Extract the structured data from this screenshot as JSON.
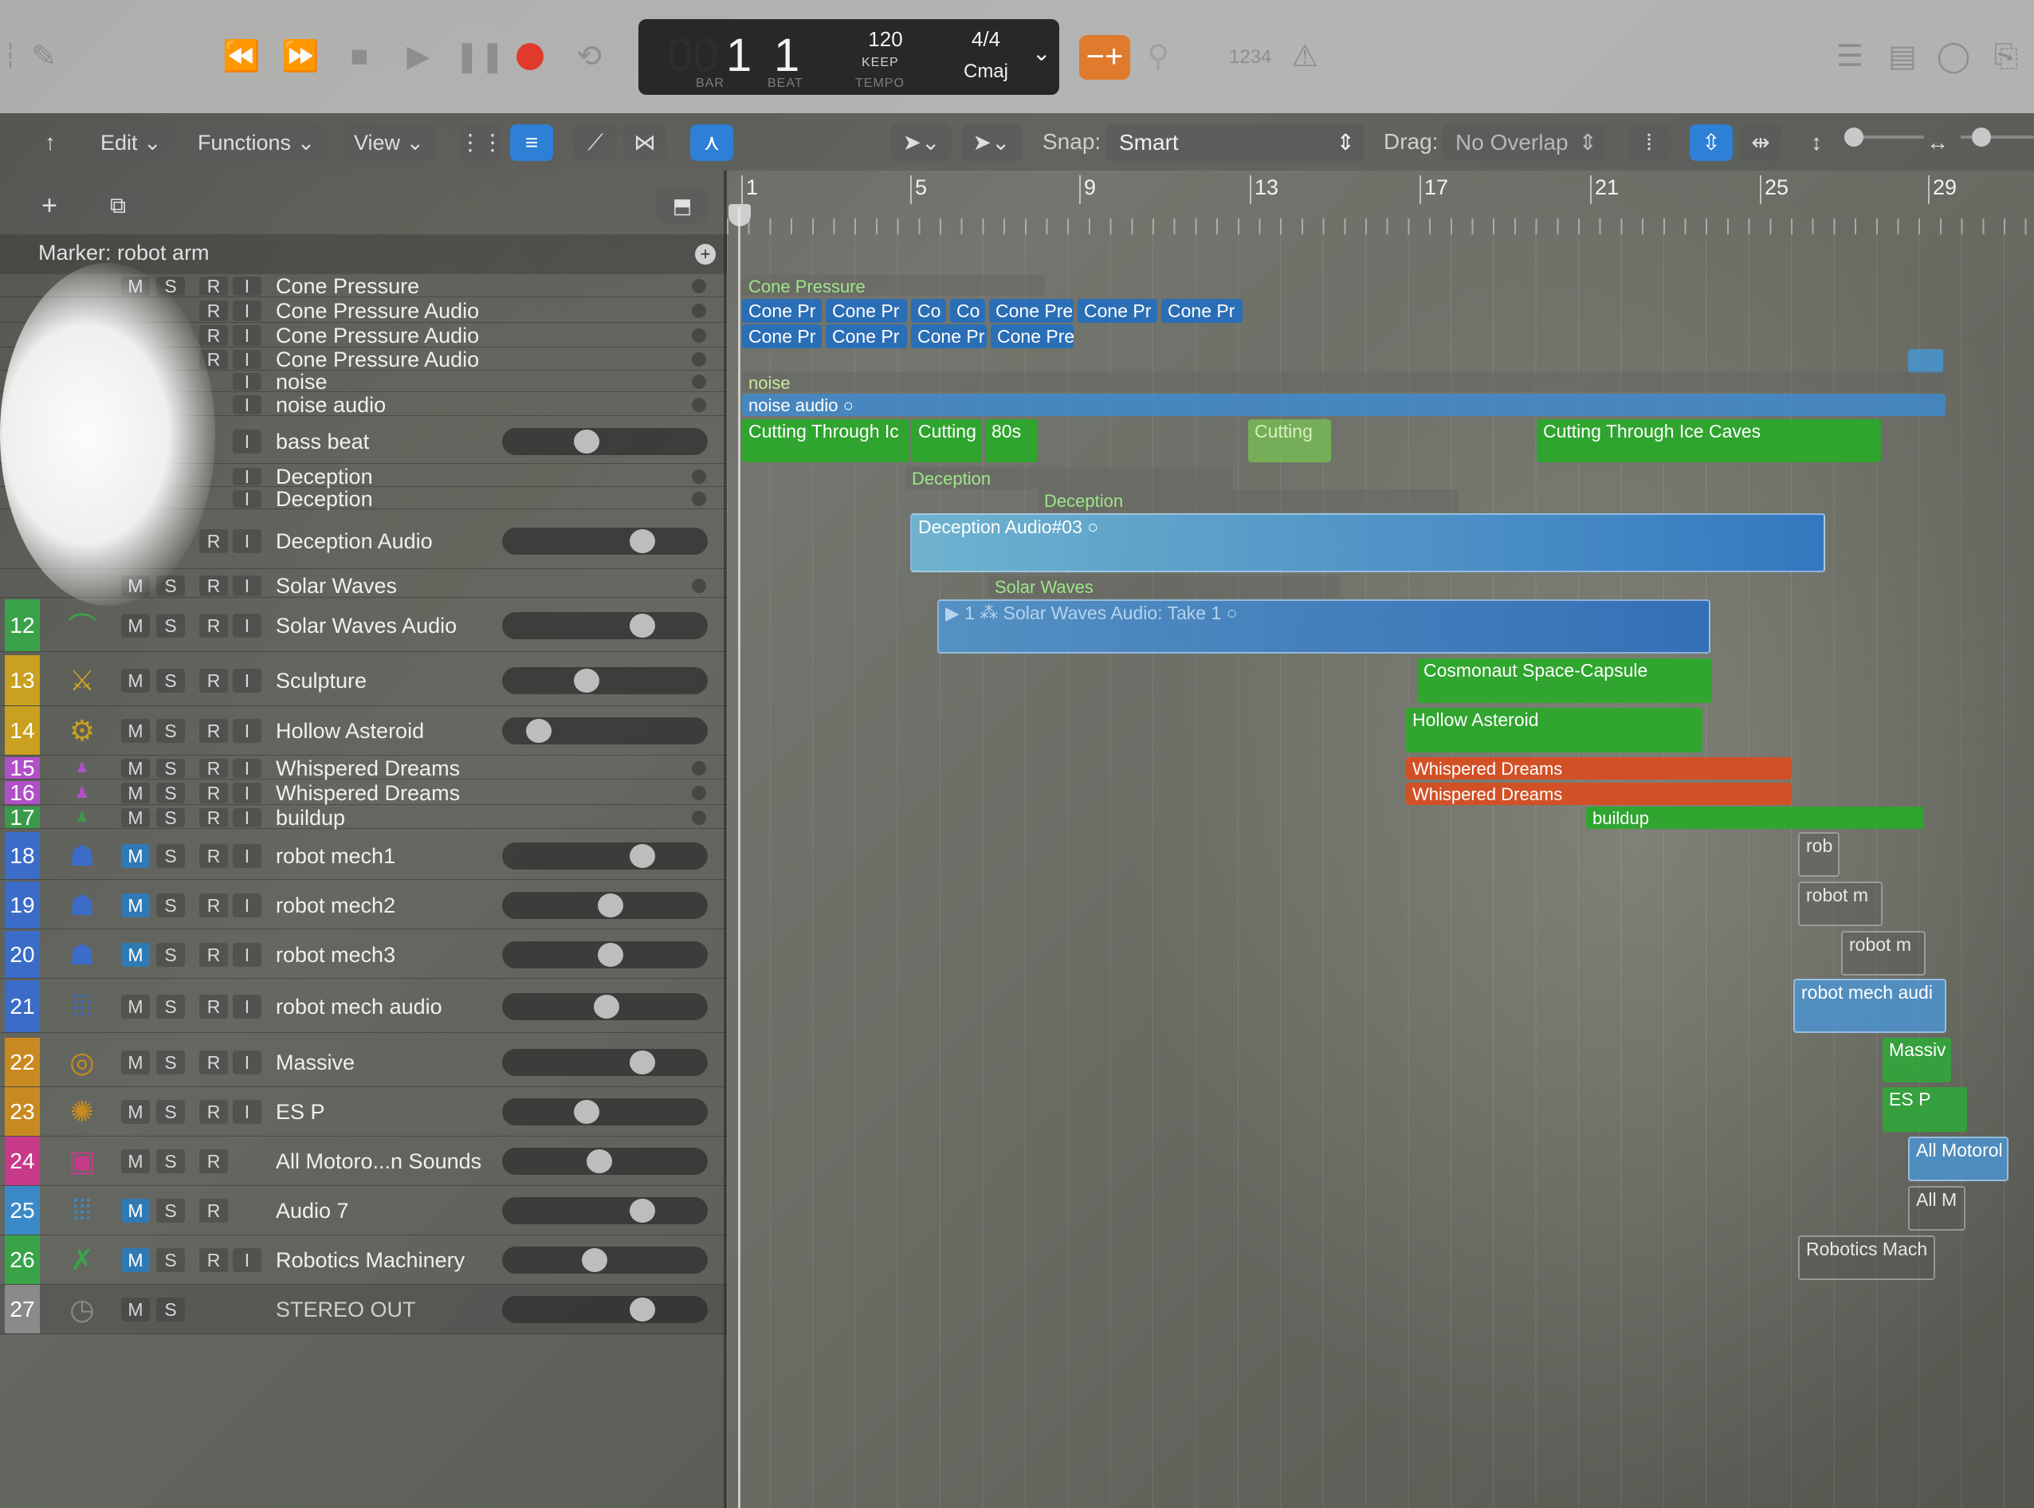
{
  "transport": {
    "bar": "00",
    "bar_value": "1",
    "beat_value": "1",
    "bar_label": "BAR",
    "beat_label": "BEAT",
    "tempo_value": "120",
    "tempo_mode": "KEEP",
    "tempo_label": "TEMPO",
    "time_signature": "4/4",
    "key": "Cmaj",
    "count_in": "1234",
    "record_color": "#e03a2c",
    "accent_color": "#e07a2c"
  },
  "toolbar": {
    "edit": "Edit",
    "functions": "Functions",
    "view": "View",
    "snap_label": "Snap:",
    "snap_value": "Smart",
    "drag_label": "Drag:",
    "drag_value": "No Overlap"
  },
  "marker": {
    "text": "Marker: robot arm"
  },
  "ruler": [
    "1",
    "5",
    "9",
    "13",
    "17",
    "21",
    "25",
    "29"
  ],
  "tracks": [
    {
      "num": "",
      "name": "Cone Pressure",
      "m": "M",
      "s": "S",
      "r": "R",
      "i": "I"
    },
    {
      "num": "",
      "name": "Cone Pressure Audio",
      "m": "",
      "s": "",
      "r": "R",
      "i": "I"
    },
    {
      "num": "",
      "name": "Cone Pressure Audio",
      "m": "",
      "s": "",
      "r": "R",
      "i": "I"
    },
    {
      "num": "",
      "name": "Cone Pressure Audio",
      "m": "",
      "s": "",
      "r": "R",
      "i": "I"
    },
    {
      "num": "",
      "name": "noise",
      "m": "",
      "s": "",
      "r": "",
      "i": "I"
    },
    {
      "num": "",
      "name": "noise audio",
      "m": "",
      "s": "",
      "r": "",
      "i": "I"
    },
    {
      "num": "",
      "name": "bass beat",
      "m": "",
      "s": "",
      "r": "",
      "i": "I"
    },
    {
      "num": "",
      "name": "Deception",
      "m": "",
      "s": "",
      "r": "",
      "i": "I"
    },
    {
      "num": "",
      "name": "Deception",
      "m": "",
      "s": "",
      "r": "",
      "i": "I"
    },
    {
      "num": "",
      "name": "Deception Audio",
      "m": "",
      "s": "",
      "r": "R",
      "i": "I"
    },
    {
      "num": "",
      "name": "Solar Waves",
      "m": "M",
      "s": "S",
      "r": "R",
      "i": "I"
    },
    {
      "num": "12",
      "name": "Solar Waves Audio",
      "m": "M",
      "s": "S",
      "r": "R",
      "i": "I"
    },
    {
      "num": "13",
      "name": "Sculpture",
      "m": "M",
      "s": "S",
      "r": "R",
      "i": "I"
    },
    {
      "num": "14",
      "name": "Hollow Asteroid",
      "m": "M",
      "s": "S",
      "r": "R",
      "i": "I"
    },
    {
      "num": "15",
      "name": "Whispered Dreams",
      "m": "M",
      "s": "S",
      "r": "R",
      "i": "I"
    },
    {
      "num": "16",
      "name": "Whispered Dreams",
      "m": "M",
      "s": "S",
      "r": "R",
      "i": "I"
    },
    {
      "num": "17",
      "name": "buildup",
      "m": "M",
      "s": "S",
      "r": "R",
      "i": "I"
    },
    {
      "num": "18",
      "name": "robot mech1",
      "m": "M",
      "s": "S",
      "r": "R",
      "i": "I"
    },
    {
      "num": "19",
      "name": "robot mech2",
      "m": "M",
      "s": "S",
      "r": "R",
      "i": "I"
    },
    {
      "num": "20",
      "name": "robot mech3",
      "m": "M",
      "s": "S",
      "r": "R",
      "i": "I"
    },
    {
      "num": "21",
      "name": "robot mech audio",
      "m": "M",
      "s": "S",
      "r": "R",
      "i": "I"
    },
    {
      "num": "22",
      "name": "Massive",
      "m": "M",
      "s": "S",
      "r": "R",
      "i": "I"
    },
    {
      "num": "23",
      "name": "ES P",
      "m": "M",
      "s": "S",
      "r": "R",
      "i": "I"
    },
    {
      "num": "24",
      "name": "All Motoro...n Sounds",
      "m": "M",
      "s": "S",
      "r": "R",
      "i": ""
    },
    {
      "num": "25",
      "name": "Audio 7",
      "m": "M",
      "s": "S",
      "r": "R",
      "i": ""
    },
    {
      "num": "26",
      "name": "Robotics Machinery",
      "m": "M",
      "s": "S",
      "r": "R",
      "i": "I"
    },
    {
      "num": "27",
      "name": "STEREO OUT",
      "m": "M",
      "s": "S",
      "r": "",
      "i": ""
    }
  ],
  "track_number_colors": {
    "12": "#3aa34a",
    "13": "#c9a020",
    "14": "#c9a020",
    "15": "#b050c8",
    "16": "#b050c8",
    "17": "#3a9a4a",
    "18": "#3b6cc7",
    "19": "#3b6cc7",
    "20": "#3b6cc7",
    "21": "#3b6cc7",
    "22": "#c88a20",
    "23": "#c88a20",
    "24": "#c73a8a",
    "25": "#3b8ac7",
    "26": "#3aa34a",
    "27": "#8a8a8a"
  },
  "regions": {
    "cone_pressure": "Cone Pressure",
    "cp_a": [
      "Cone Pr",
      "Cone Pr",
      "Co",
      "Co",
      "Cone Pre",
      "Cone Pr",
      "Cone Pr"
    ],
    "cp_b": [
      "Cone Pr",
      "Cone Pr",
      "Cone Pr",
      "Cone Pre"
    ],
    "noise": "noise",
    "noise_audio": "noise audio",
    "bass1": "Cutting Through Ic",
    "bass2": "Cutting",
    "bass3": "80s",
    "bass4": "Cutting",
    "bass5": "Cutting Through Ice Caves",
    "deception1": "Deception",
    "deception2": "Deception",
    "deception_audio": "Deception Audio#03",
    "solar_waves": "Solar Waves",
    "solar_take_num": "1",
    "solar_take": "Solar Waves Audio: Take 1",
    "sculpture": "Cosmonaut Space-Capsule",
    "hollow": "Hollow Asteroid",
    "wd1": "Whispered Dreams",
    "wd2": "Whispered Dreams",
    "buildup": "buildup",
    "rm1": "rob",
    "rm2": "robot m",
    "rm3": "robot m",
    "rma": "robot mech audi",
    "massive": "Massiv",
    "esp": "ES P",
    "allmotor": "All Motorol",
    "audio7": "All M",
    "robotics": "Robotics Mach"
  }
}
